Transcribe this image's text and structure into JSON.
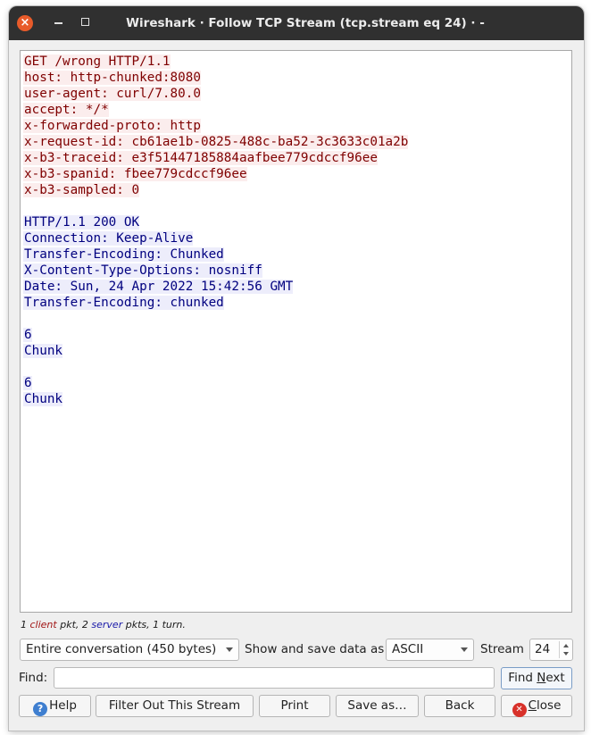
{
  "window": {
    "title": "Wireshark · Follow TCP Stream (tcp.stream eq 24) · -"
  },
  "stream": {
    "client_lines": [
      "GET /wrong HTTP/1.1",
      "host: http-chunked:8080",
      "user-agent: curl/7.80.0",
      "accept: */*",
      "x-forwarded-proto: http",
      "x-request-id: cb61ae1b-0825-488c-ba52-3c3633c01a2b",
      "x-b3-traceid: e3f51447185884aafbee779cdccf96ee",
      "x-b3-spanid: fbee779cdccf96ee",
      "x-b3-sampled: 0"
    ],
    "server_lines": [
      "HTTP/1.1 200 OK",
      "Connection: Keep-Alive",
      "Transfer-Encoding: Chunked",
      "X-Content-Type-Options: nosniff",
      "Date: Sun, 24 Apr 2022 15:42:56 GMT",
      "Transfer-Encoding: chunked"
    ],
    "chunks": [
      {
        "size": "6",
        "body": "Chunk"
      },
      {
        "size": "6",
        "body": "Chunk"
      }
    ],
    "client_color": "#7f0000",
    "client_bg": "#fbeded",
    "server_color": "#00007f",
    "server_bg": "#ededfb"
  },
  "summary": {
    "client_count": "1",
    "client_word": "client",
    "pkt_word": "pkt,",
    "server_count": "2",
    "server_word": "server",
    "pkts_word": "pkts,",
    "turn": "1 turn."
  },
  "controls": {
    "conversation_select": "Entire conversation (450 bytes)",
    "show_save_label": "Show and save data as",
    "format_select": "ASCII",
    "stream_label": "Stream",
    "stream_value": "24",
    "find_label": "Find:",
    "find_value": "",
    "find_next_pre": "Find ",
    "find_next_u": "N",
    "find_next_post": "ext"
  },
  "buttons": {
    "help": "Help",
    "filter_out": "Filter Out This Stream",
    "print": "Print",
    "save_as": "Save as…",
    "back": "Back",
    "close_u": "C",
    "close_rest": "lose"
  },
  "icons": {
    "help": "help-icon",
    "close": "close-icon"
  }
}
